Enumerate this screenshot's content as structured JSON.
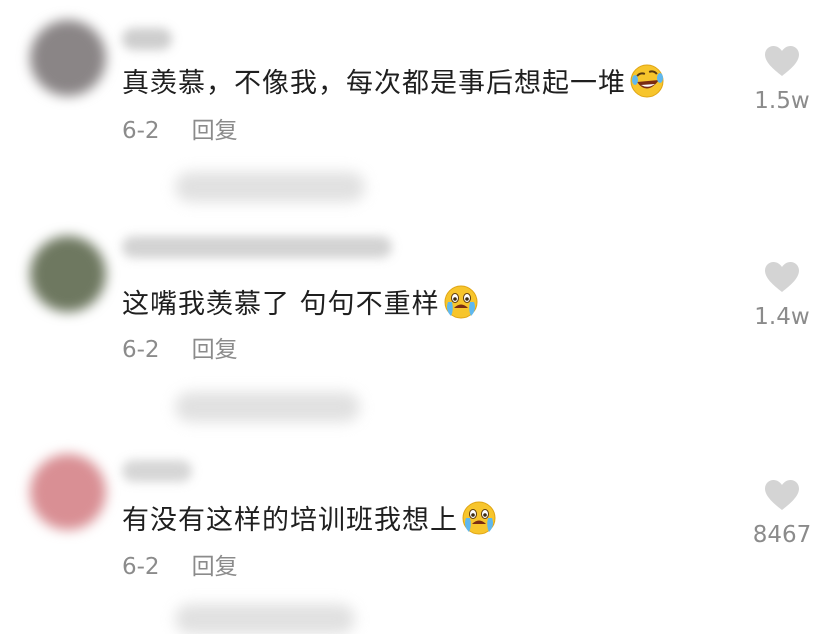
{
  "comments": [
    {
      "text": "真羡慕，不像我，每次都是事后想起一堆",
      "emoji": "laughing-crying-icon",
      "date": "6-2",
      "reply_label": "回复",
      "likes": "1.5w"
    },
    {
      "text": "这嘴我羡慕了 句句不重样",
      "emoji": "crying-icon",
      "date": "6-2",
      "reply_label": "回复",
      "likes": "1.4w"
    },
    {
      "text": "有没有这样的培训班我想上",
      "emoji": "crying-icon",
      "date": "6-2",
      "reply_label": "回复",
      "likes": "8467"
    }
  ]
}
